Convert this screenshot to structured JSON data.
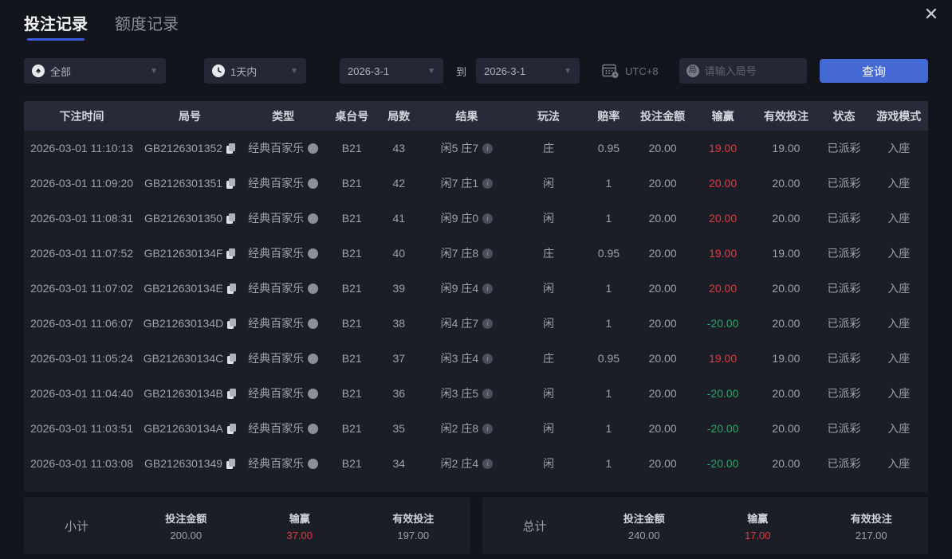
{
  "window": {
    "close_glyph": "✕"
  },
  "tabs": [
    {
      "label": "投注记录",
      "active": true
    },
    {
      "label": "额度记录",
      "active": false
    }
  ],
  "filters": {
    "game_type": {
      "value": "全部",
      "icon": "spade",
      "icon_glyph": "♠"
    },
    "time_range": {
      "value": "1天内",
      "icon": "clock"
    },
    "date_from": "2026-3-1",
    "to_label": "到",
    "date_to": "2026-3-1",
    "timezone_label": "UTC+8",
    "round_input": {
      "value": "",
      "placeholder": "请输入局号",
      "icon_glyph": "局"
    },
    "search_button_label": "查询"
  },
  "table": {
    "headers": [
      "下注时间",
      "局号",
      "类型",
      "桌台号",
      "局数",
      "结果",
      "玩法",
      "赔率",
      "投注金额",
      "输赢",
      "有效投注",
      "状态",
      "游戏模式"
    ],
    "rows": [
      {
        "time": "2026-03-01 11:10:13",
        "round_id": "GB2126301352",
        "type": "经典百家乐",
        "table_no": "B21",
        "round_no": "43",
        "result": "闲5 庄7",
        "play": "庄",
        "odds": "0.95",
        "bet": "20.00",
        "win_loss": "19.00",
        "valid_bet": "19.00",
        "status": "已派彩",
        "mode": "入座"
      },
      {
        "time": "2026-03-01 11:09:20",
        "round_id": "GB2126301351",
        "type": "经典百家乐",
        "table_no": "B21",
        "round_no": "42",
        "result": "闲7 庄1",
        "play": "闲",
        "odds": "1",
        "bet": "20.00",
        "win_loss": "20.00",
        "valid_bet": "20.00",
        "status": "已派彩",
        "mode": "入座"
      },
      {
        "time": "2026-03-01 11:08:31",
        "round_id": "GB2126301350",
        "type": "经典百家乐",
        "table_no": "B21",
        "round_no": "41",
        "result": "闲9 庄0",
        "play": "闲",
        "odds": "1",
        "bet": "20.00",
        "win_loss": "20.00",
        "valid_bet": "20.00",
        "status": "已派彩",
        "mode": "入座"
      },
      {
        "time": "2026-03-01 11:07:52",
        "round_id": "GB212630134F",
        "type": "经典百家乐",
        "table_no": "B21",
        "round_no": "40",
        "result": "闲7 庄8",
        "play": "庄",
        "odds": "0.95",
        "bet": "20.00",
        "win_loss": "19.00",
        "valid_bet": "19.00",
        "status": "已派彩",
        "mode": "入座"
      },
      {
        "time": "2026-03-01 11:07:02",
        "round_id": "GB212630134E",
        "type": "经典百家乐",
        "table_no": "B21",
        "round_no": "39",
        "result": "闲9 庄4",
        "play": "闲",
        "odds": "1",
        "bet": "20.00",
        "win_loss": "20.00",
        "valid_bet": "20.00",
        "status": "已派彩",
        "mode": "入座"
      },
      {
        "time": "2026-03-01 11:06:07",
        "round_id": "GB212630134D",
        "type": "经典百家乐",
        "table_no": "B21",
        "round_no": "38",
        "result": "闲4 庄7",
        "play": "闲",
        "odds": "1",
        "bet": "20.00",
        "win_loss": "-20.00",
        "valid_bet": "20.00",
        "status": "已派彩",
        "mode": "入座"
      },
      {
        "time": "2026-03-01 11:05:24",
        "round_id": "GB212630134C",
        "type": "经典百家乐",
        "table_no": "B21",
        "round_no": "37",
        "result": "闲3 庄4",
        "play": "庄",
        "odds": "0.95",
        "bet": "20.00",
        "win_loss": "19.00",
        "valid_bet": "19.00",
        "status": "已派彩",
        "mode": "入座"
      },
      {
        "time": "2026-03-01 11:04:40",
        "round_id": "GB212630134B",
        "type": "经典百家乐",
        "table_no": "B21",
        "round_no": "36",
        "result": "闲3 庄5",
        "play": "闲",
        "odds": "1",
        "bet": "20.00",
        "win_loss": "-20.00",
        "valid_bet": "20.00",
        "status": "已派彩",
        "mode": "入座"
      },
      {
        "time": "2026-03-01 11:03:51",
        "round_id": "GB212630134A",
        "type": "经典百家乐",
        "table_no": "B21",
        "round_no": "35",
        "result": "闲2 庄8",
        "play": "闲",
        "odds": "1",
        "bet": "20.00",
        "win_loss": "-20.00",
        "valid_bet": "20.00",
        "status": "已派彩",
        "mode": "入座"
      },
      {
        "time": "2026-03-01 11:03:08",
        "round_id": "GB2126301349",
        "type": "经典百家乐",
        "table_no": "B21",
        "round_no": "34",
        "result": "闲2 庄4",
        "play": "闲",
        "odds": "1",
        "bet": "20.00",
        "win_loss": "-20.00",
        "valid_bet": "20.00",
        "status": "已派彩",
        "mode": "入座"
      }
    ]
  },
  "subtotal": {
    "label": "小计",
    "bet_label": "投注金额",
    "bet_value": "200.00",
    "winloss_label": "输赢",
    "winloss_value": "37.00",
    "valid_label": "有效投注",
    "valid_value": "197.00"
  },
  "total": {
    "label": "总计",
    "bet_label": "投注金额",
    "bet_value": "240.00",
    "winloss_label": "输赢",
    "winloss_value": "17.00",
    "valid_label": "有效投注",
    "valid_value": "217.00"
  },
  "colors": {
    "accent_blue": "#4468d4",
    "win_red": "#e03b41",
    "loss_green": "#29a564",
    "tab_underline": "#3d5ce0"
  }
}
